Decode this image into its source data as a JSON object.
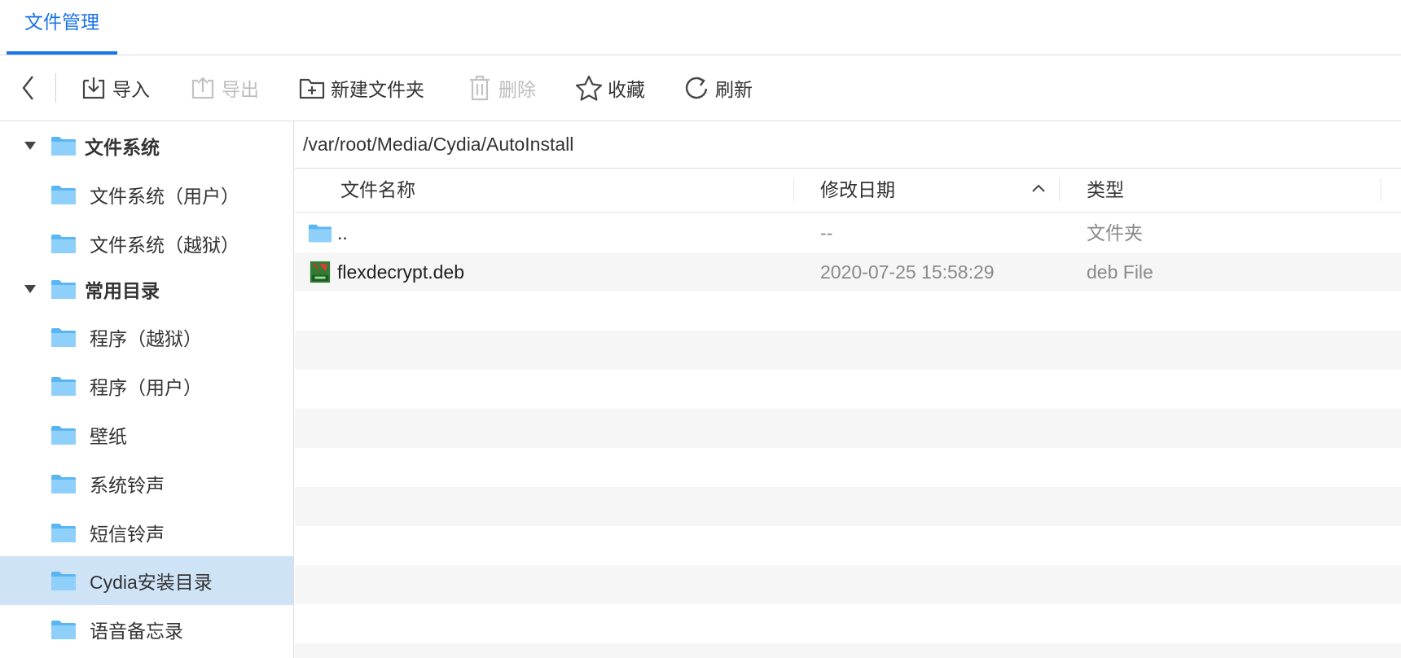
{
  "tab": {
    "label": "文件管理"
  },
  "toolbar": {
    "import": "导入",
    "export": "导出",
    "new_folder": "新建文件夹",
    "delete": "删除",
    "favorite": "收藏",
    "refresh": "刷新"
  },
  "sidebar": {
    "groups": [
      {
        "label": "文件系统",
        "children": [
          "文件系统（用户）",
          "文件系统（越狱）"
        ]
      },
      {
        "label": "常用目录",
        "children": [
          "程序（越狱）",
          "程序（用户）",
          "壁纸",
          "系统铃声",
          "短信铃声",
          "Cydia安装目录",
          "语音备忘录"
        ]
      }
    ],
    "selected": "Cydia安装目录"
  },
  "path": "/var/root/Media/Cydia/AutoInstall",
  "table": {
    "columns": [
      "文件名称",
      "修改日期",
      "类型"
    ],
    "rows": [
      {
        "name": "..",
        "date": "--",
        "type": "文件夹",
        "icon": "folder-icon"
      },
      {
        "name": "flexdecrypt.deb",
        "date": "2020-07-25 15:58:29",
        "type": "deb File",
        "icon": "deb-file-icon"
      }
    ]
  },
  "colors": {
    "accent": "#1a73e8",
    "selected_bg": "#cfe3f7",
    "folder": "#6cc0f5"
  }
}
